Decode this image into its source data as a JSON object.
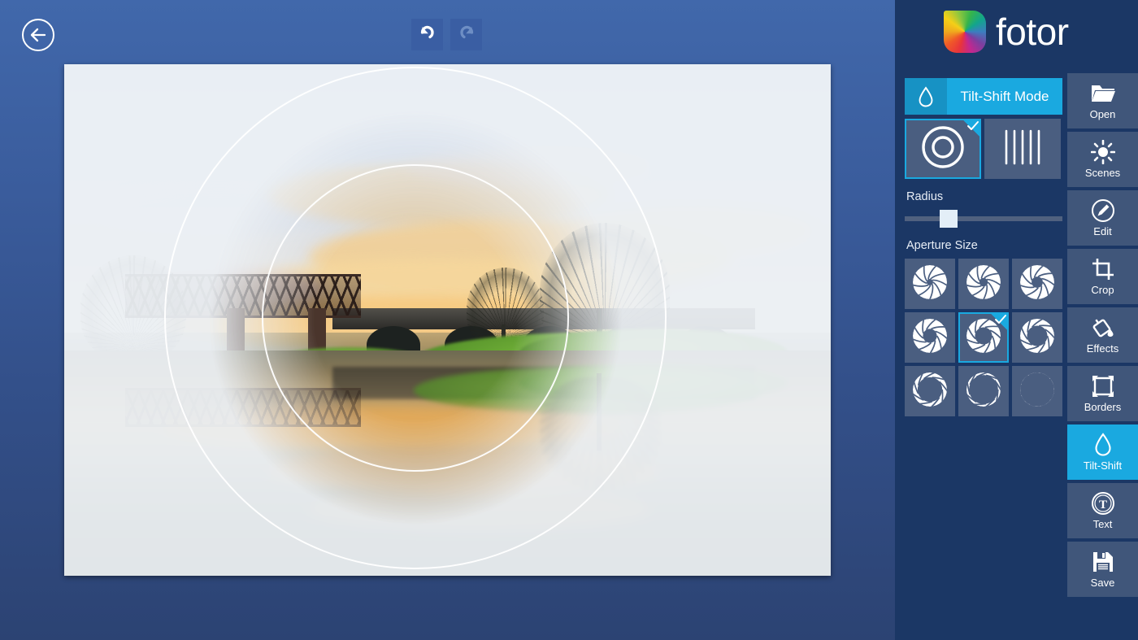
{
  "app": {
    "brand_name": "fotor",
    "brand_logo_icon": "fotor-color-wheel-logo"
  },
  "workspace": {
    "back_button_icon": "back-arrow-circle-icon",
    "history": [
      {
        "name": "undo",
        "icon": "undo-arrow-icon",
        "enabled": true
      },
      {
        "name": "redo",
        "icon": "redo-arrow-icon",
        "enabled": false
      }
    ],
    "photo": {
      "description": "Sunset landscape with iron truss and stone arch bridge over still river, green grassy bank, bare trees, mirrored reflection in water",
      "tilt_shift_overlay": {
        "shape": "circular",
        "outer_ring_icon": "focus-ring-outer",
        "inner_ring_icon": "focus-ring-inner"
      }
    }
  },
  "panel": {
    "mode_button": {
      "label": "Tilt-Shift Mode",
      "icon": "water-drop-icon",
      "accent_color": "#1aa9e0"
    },
    "shapes": [
      {
        "name": "circular",
        "icon": "concentric-circles-icon",
        "selected": true
      },
      {
        "name": "linear",
        "icon": "vertical-lines-icon",
        "selected": false
      }
    ],
    "radius": {
      "label": "Radius",
      "value_percent": 28
    },
    "aperture": {
      "label": "Aperture Size",
      "tiles": [
        {
          "name": "aperture-1",
          "icon": "iris-aperture-icon",
          "opening": 12,
          "blades": 9,
          "selected": false
        },
        {
          "name": "aperture-2",
          "icon": "iris-aperture-icon",
          "opening": 16,
          "blades": 9,
          "selected": false
        },
        {
          "name": "aperture-3",
          "icon": "iris-aperture-icon",
          "opening": 21,
          "blades": 9,
          "selected": false
        },
        {
          "name": "aperture-4",
          "icon": "iris-aperture-icon",
          "opening": 26,
          "blades": 9,
          "selected": false
        },
        {
          "name": "aperture-5",
          "icon": "iris-aperture-icon",
          "opening": 32,
          "blades": 9,
          "selected": true
        },
        {
          "name": "aperture-6",
          "icon": "iris-aperture-icon",
          "opening": 38,
          "blades": 9,
          "selected": false
        },
        {
          "name": "aperture-7",
          "icon": "iris-aperture-icon",
          "opening": 46,
          "blades": 9,
          "selected": false
        },
        {
          "name": "aperture-8",
          "icon": "iris-aperture-icon",
          "opening": 54,
          "blades": 9,
          "selected": false
        },
        {
          "name": "aperture-9",
          "icon": "iris-aperture-icon",
          "opening": 62,
          "blades": 9,
          "selected": false
        }
      ]
    }
  },
  "rail": {
    "items": [
      {
        "label": "Open",
        "icon": "folder-icon",
        "active": false
      },
      {
        "label": "Scenes",
        "icon": "sun-icon",
        "active": false
      },
      {
        "label": "Edit",
        "icon": "pencil-circle-icon",
        "active": false
      },
      {
        "label": "Crop",
        "icon": "crop-icon",
        "active": false
      },
      {
        "label": "Effects",
        "icon": "paint-bucket-icon",
        "active": false
      },
      {
        "label": "Borders",
        "icon": "borders-icon",
        "active": false
      },
      {
        "label": "Tilt-Shift",
        "icon": "water-drop-icon",
        "active": true
      },
      {
        "label": "Text",
        "icon": "text-circle-icon",
        "active": false
      },
      {
        "label": "Save",
        "icon": "floppy-disk-icon",
        "active": false
      }
    ]
  },
  "colors": {
    "accent": "#1aa9e0",
    "panel_bg": "#1b3765",
    "tile_bg": "#4a5e80",
    "rail_bg": "#40567a"
  }
}
